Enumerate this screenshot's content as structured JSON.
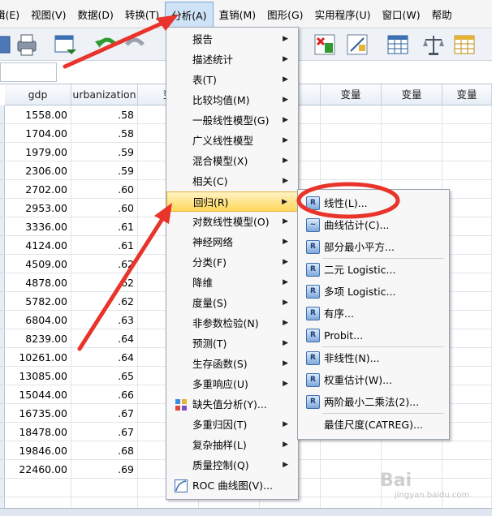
{
  "menubar": {
    "items": [
      {
        "label": "辑(E)"
      },
      {
        "label": "视图(V)"
      },
      {
        "label": "数据(D)"
      },
      {
        "label": "转换(T)"
      },
      {
        "label": "分析(A)"
      },
      {
        "label": "直销(M)"
      },
      {
        "label": "图形(G)"
      },
      {
        "label": "实用程序(U)"
      },
      {
        "label": "窗口(W)"
      },
      {
        "label": "帮助"
      }
    ]
  },
  "grid": {
    "columns": [
      "gdp",
      "urbanization",
      "变",
      "变量",
      "变量",
      "变量",
      "变量"
    ],
    "rows": [
      [
        "1558.00",
        ".58"
      ],
      [
        "1704.00",
        ".58"
      ],
      [
        "1979.00",
        ".59"
      ],
      [
        "2306.00",
        ".59"
      ],
      [
        "2702.00",
        ".60"
      ],
      [
        "2953.00",
        ".60"
      ],
      [
        "3336.00",
        ".61"
      ],
      [
        "4124.00",
        ".61"
      ],
      [
        "4509.00",
        ".62"
      ],
      [
        "4878.00",
        ".62"
      ],
      [
        "5782.00",
        ".62"
      ],
      [
        "6804.00",
        ".63"
      ],
      [
        "8239.00",
        ".64"
      ],
      [
        "10261.00",
        ".64"
      ],
      [
        "13085.00",
        ".65"
      ],
      [
        "15044.00",
        ".66"
      ],
      [
        "16735.00",
        ".67"
      ],
      [
        "18478.00",
        ".67"
      ],
      [
        "19846.00",
        ".68"
      ],
      [
        "22460.00",
        ".69"
      ]
    ]
  },
  "analyze_menu": {
    "items": [
      {
        "label": "报告"
      },
      {
        "label": "描述统计"
      },
      {
        "label": "表(T)"
      },
      {
        "label": "比较均值(M)"
      },
      {
        "label": "一般线性模型(G)"
      },
      {
        "label": "广义线性模型"
      },
      {
        "label": "混合模型(X)"
      },
      {
        "label": "相关(C)"
      },
      {
        "label": "回归(R)"
      },
      {
        "label": "对数线性模型(O)"
      },
      {
        "label": "神经网络"
      },
      {
        "label": "分类(F)"
      },
      {
        "label": "降维"
      },
      {
        "label": "度量(S)"
      },
      {
        "label": "非参数检验(N)"
      },
      {
        "label": "预测(T)"
      },
      {
        "label": "生存函数(S)"
      },
      {
        "label": "多重响应(U)"
      },
      {
        "label": "缺失值分析(Y)..."
      },
      {
        "label": "多重归因(T)"
      },
      {
        "label": "复杂抽样(L)"
      },
      {
        "label": "质量控制(Q)"
      },
      {
        "label": "ROC 曲线图(V)..."
      }
    ]
  },
  "regression_menu": {
    "items": [
      {
        "label": "线性(L)..."
      },
      {
        "label": "曲线估计(C)..."
      },
      {
        "label": "部分最小平方..."
      },
      {
        "label": "二元 Logistic..."
      },
      {
        "label": "多项 Logistic..."
      },
      {
        "label": "有序..."
      },
      {
        "label": "Probit..."
      },
      {
        "label": "非线性(N)..."
      },
      {
        "label": "权重估计(W)..."
      },
      {
        "label": "两阶最小二乘法(2)..."
      },
      {
        "label": "最佳尺度(CATREG)..."
      }
    ]
  },
  "colors": {
    "highlight": "#ffd75a",
    "annotation_red": "#e8342a"
  },
  "watermark": {
    "brand": "Bai",
    "sub": "jingyan.baidu.com"
  }
}
